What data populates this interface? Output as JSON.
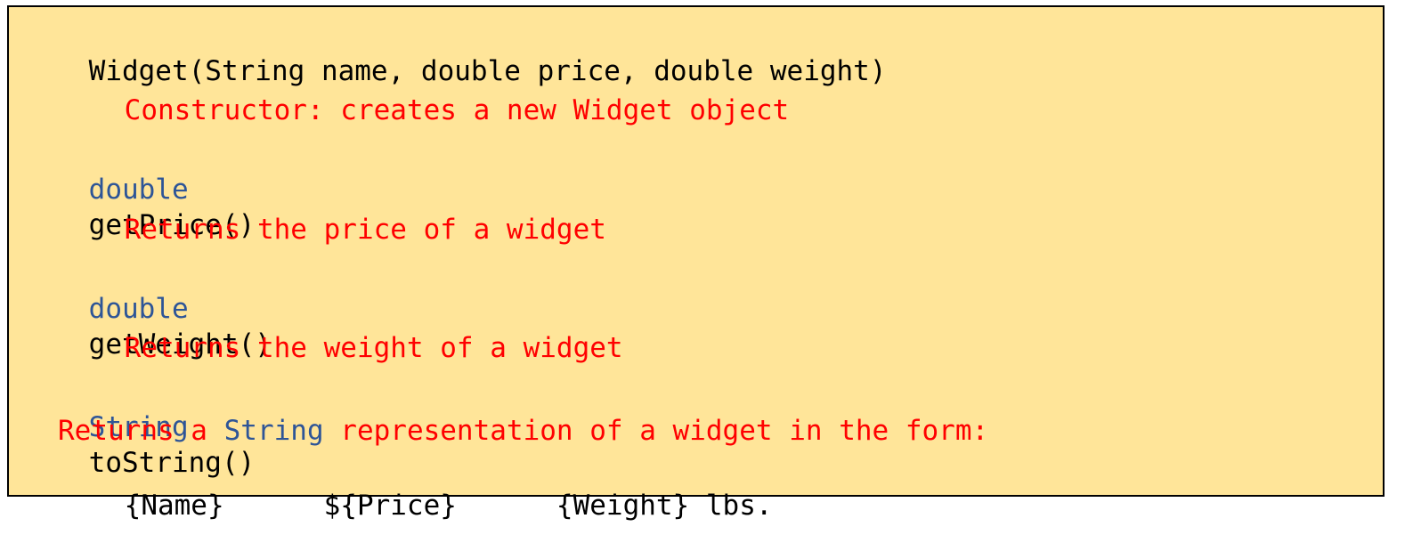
{
  "colors": {
    "background": "#ffe599",
    "border": "#000000",
    "type_keyword": "#2e5597",
    "description": "#ff0000",
    "code": "#000000"
  },
  "methods": [
    {
      "return_type": "",
      "signature": "Widget(String name, double price, double weight)",
      "description": "Constructor: creates a new Widget object"
    },
    {
      "return_type": "double",
      "signature": "getPrice()",
      "description": "Returns the price of a widget"
    },
    {
      "return_type": "double",
      "signature": "getWeight()",
      "description": "Returns the weight of a widget"
    },
    {
      "return_type": "String",
      "signature": "toString()",
      "description_parts": [
        "Returns a ",
        "String",
        " representation of a widget in the form:"
      ],
      "format": "{Name}      ${Price}      {Weight} lbs."
    }
  ]
}
